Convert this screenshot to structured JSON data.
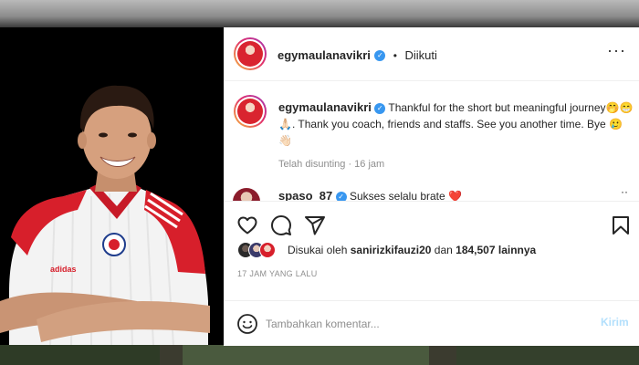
{
  "post": {
    "author": "egymaulanavikri",
    "follow_separator": "•",
    "follow_status": "Diikuti",
    "more_icon": "more-horizontal-icon",
    "caption_text": "Thankful for the short but meaningful journey🤭😁🙏🏻. Thank you coach, friends and staffs. See you another time. Bye 🥲👋🏻",
    "edited_label": "Telah disunting",
    "caption_age": "16 jam"
  },
  "comment": {
    "username": "spaso_87",
    "text": "Sukses selalu brate ❤️"
  },
  "actions": {
    "icons": [
      "heart-icon",
      "comment-icon",
      "share-icon",
      "bookmark-icon"
    ]
  },
  "likes": {
    "prefix": "Disukai oleh",
    "user": "sanirizkifauzi20",
    "connector": "dan",
    "count": "184,507 lainnya"
  },
  "timestamp": "17 JAM YANG LALU",
  "add_comment": {
    "placeholder": "Tambahkan komentar...",
    "post_label": "Kirim"
  },
  "colors": {
    "verified_blue": "#3897f0",
    "post_button_disabled": "#b2dffc",
    "secondary_text": "#8e8e8e"
  }
}
